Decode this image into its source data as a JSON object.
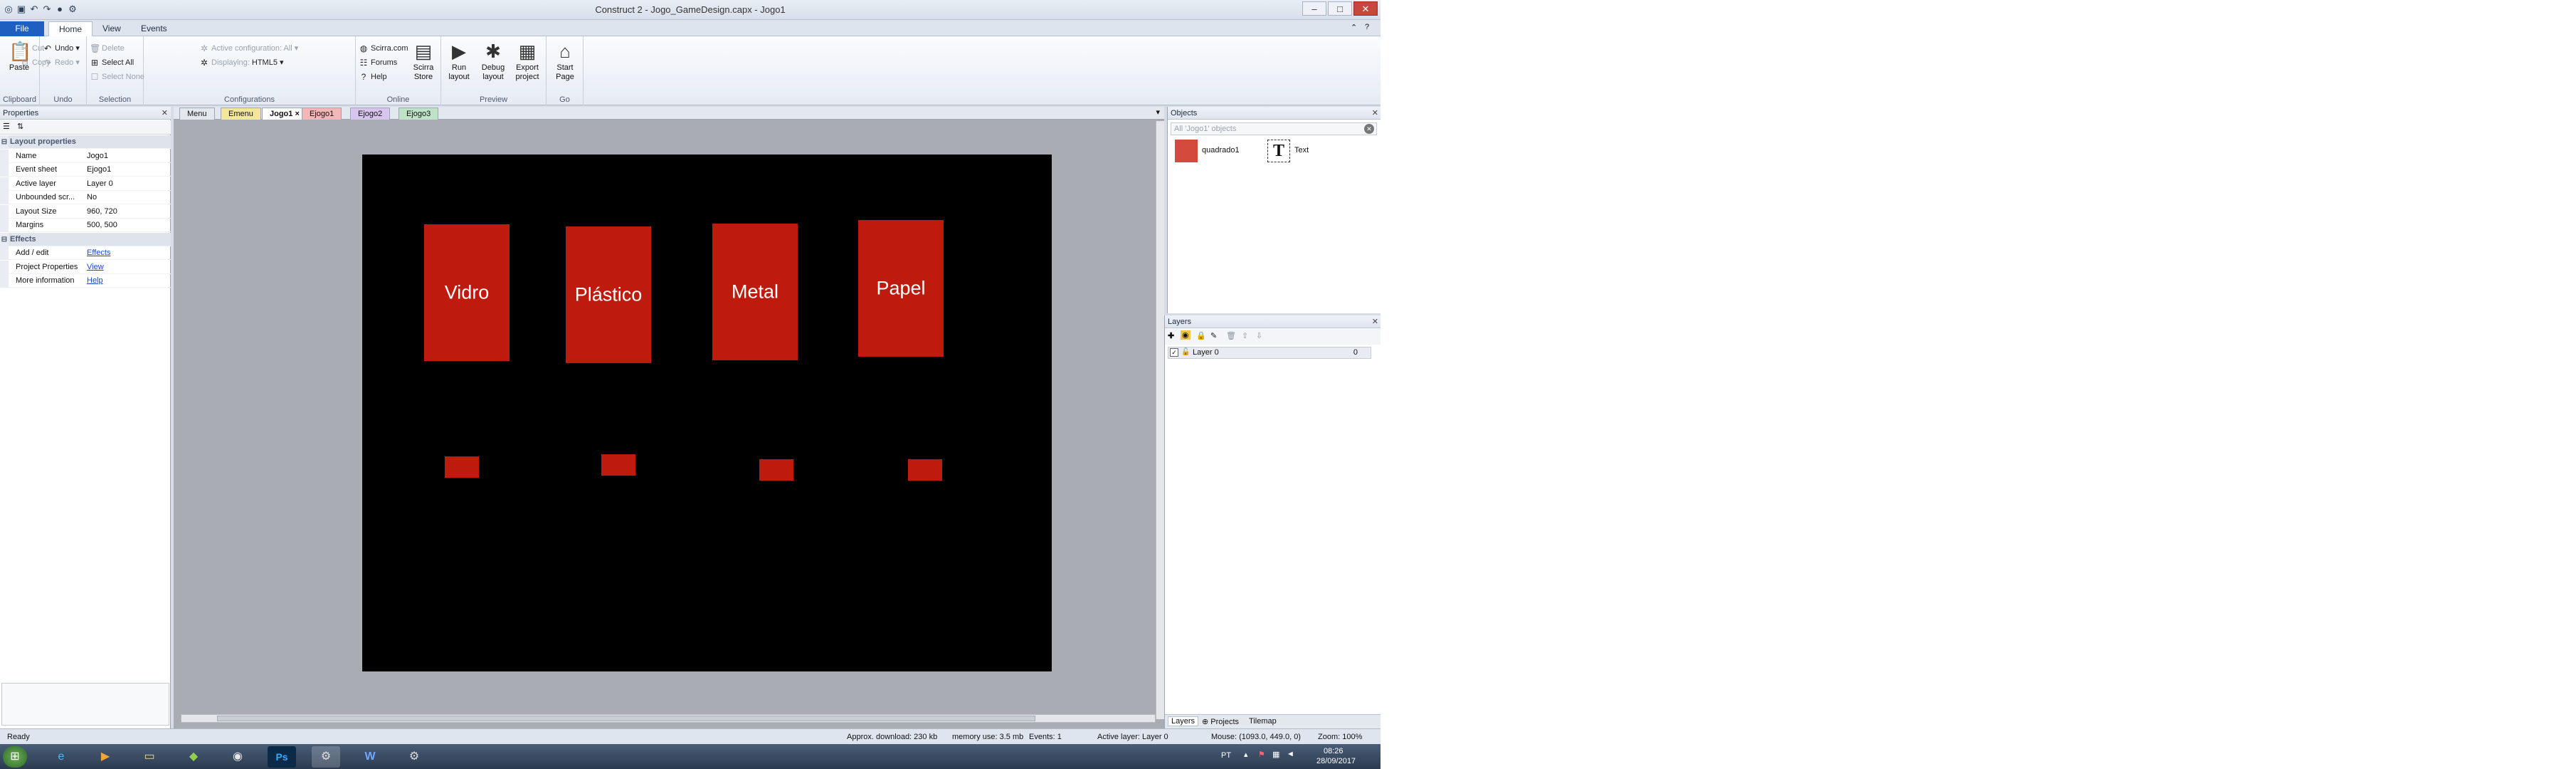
{
  "window": {
    "title": "Construct 2 - Jogo_GameDesign.capx - Jogo1"
  },
  "quick_access": {
    "icons": [
      "logo-icon",
      "save-icon",
      "undo-icon",
      "redo-icon",
      "stop-icon",
      "settings-icon"
    ]
  },
  "ribbon_tabs": [
    "File",
    "Home",
    "View",
    "Events"
  ],
  "ribbon": {
    "clipboard": {
      "label": "Clipboard",
      "paste": "Paste",
      "cut": "Cut",
      "copy": "Copy"
    },
    "undo": {
      "label": "Undo",
      "undo": "Undo",
      "redo": "Redo"
    },
    "selection": {
      "label": "Selection",
      "delete": "Delete",
      "select_all": "Select All",
      "select_none": "Select None"
    },
    "configurations": {
      "label": "Configurations",
      "active": "Active configuration: All",
      "displaying_label": "Displaying:",
      "displaying_value": "HTML5"
    },
    "online": {
      "label": "Online",
      "scirra": "Scirra.com",
      "forums": "Forums",
      "help": "Help",
      "store": "Scirra Store"
    },
    "preview": {
      "label": "Preview",
      "run": "Run layout",
      "debug": "Debug layout",
      "export": "Export project"
    },
    "go": {
      "label": "Go",
      "start": "Start Page"
    }
  },
  "properties": {
    "title": "Properties",
    "rows": [
      {
        "k": "Layout properties",
        "v": "",
        "cat": true
      },
      {
        "k": "Name",
        "v": "Jogo1"
      },
      {
        "k": "Event sheet",
        "v": "Ejogo1"
      },
      {
        "k": "Active layer",
        "v": "Layer 0"
      },
      {
        "k": "Unbounded scr...",
        "v": "No"
      },
      {
        "k": "Layout Size",
        "v": "960, 720"
      },
      {
        "k": "Margins",
        "v": "500, 500"
      },
      {
        "k": "Effects",
        "v": "",
        "cat": true
      },
      {
        "k": "Add / edit",
        "v": "Effects",
        "link": true
      },
      {
        "k": "Project Properties",
        "v": "View",
        "link": true
      },
      {
        "k": "More information",
        "v": "Help",
        "link": true
      }
    ]
  },
  "doc_tabs": [
    {
      "label": "Menu",
      "color": "#e3e8ef"
    },
    {
      "label": "Emenu",
      "color": "#f3e79a"
    },
    {
      "label": "Jogo1",
      "color": "#f3e79a",
      "active": true
    },
    {
      "label": "Ejogo1",
      "color": "#f3b7b7"
    },
    {
      "label": "Ejogo2",
      "color": "#d7c5ee"
    },
    {
      "label": "Ejogo3",
      "color": "#bfe3c6"
    }
  ],
  "canvas": {
    "cards": [
      "Vidro",
      "Plástico",
      "Metal",
      "Papel"
    ],
    "card_color": "#bf1a0e",
    "background": "#000000"
  },
  "objects": {
    "title": "Objects",
    "filter_placeholder": "All 'Jogo1' objects",
    "items": [
      {
        "name": "quadrado1",
        "icon": "red-square-icon"
      },
      {
        "name": "Text",
        "icon": "text-icon"
      }
    ]
  },
  "layers": {
    "title": "Layers",
    "items": [
      {
        "name": "Layer 0",
        "value": "0"
      }
    ],
    "bottom_tabs": [
      "Layers",
      "Projects",
      "Tilemap"
    ]
  },
  "status": {
    "ready": "Ready",
    "download": "Approx. download: 230 kb",
    "memory": "memory use: 3.5 mb",
    "events": "Events: 1",
    "active_layer": "Active layer: Layer 0",
    "mouse": "Mouse: (1093.0, 449.0, 0)",
    "zoom": "Zoom: 100%"
  },
  "taskbar": {
    "lang": "PT",
    "time": "08:26",
    "date": "28/09/2017"
  }
}
